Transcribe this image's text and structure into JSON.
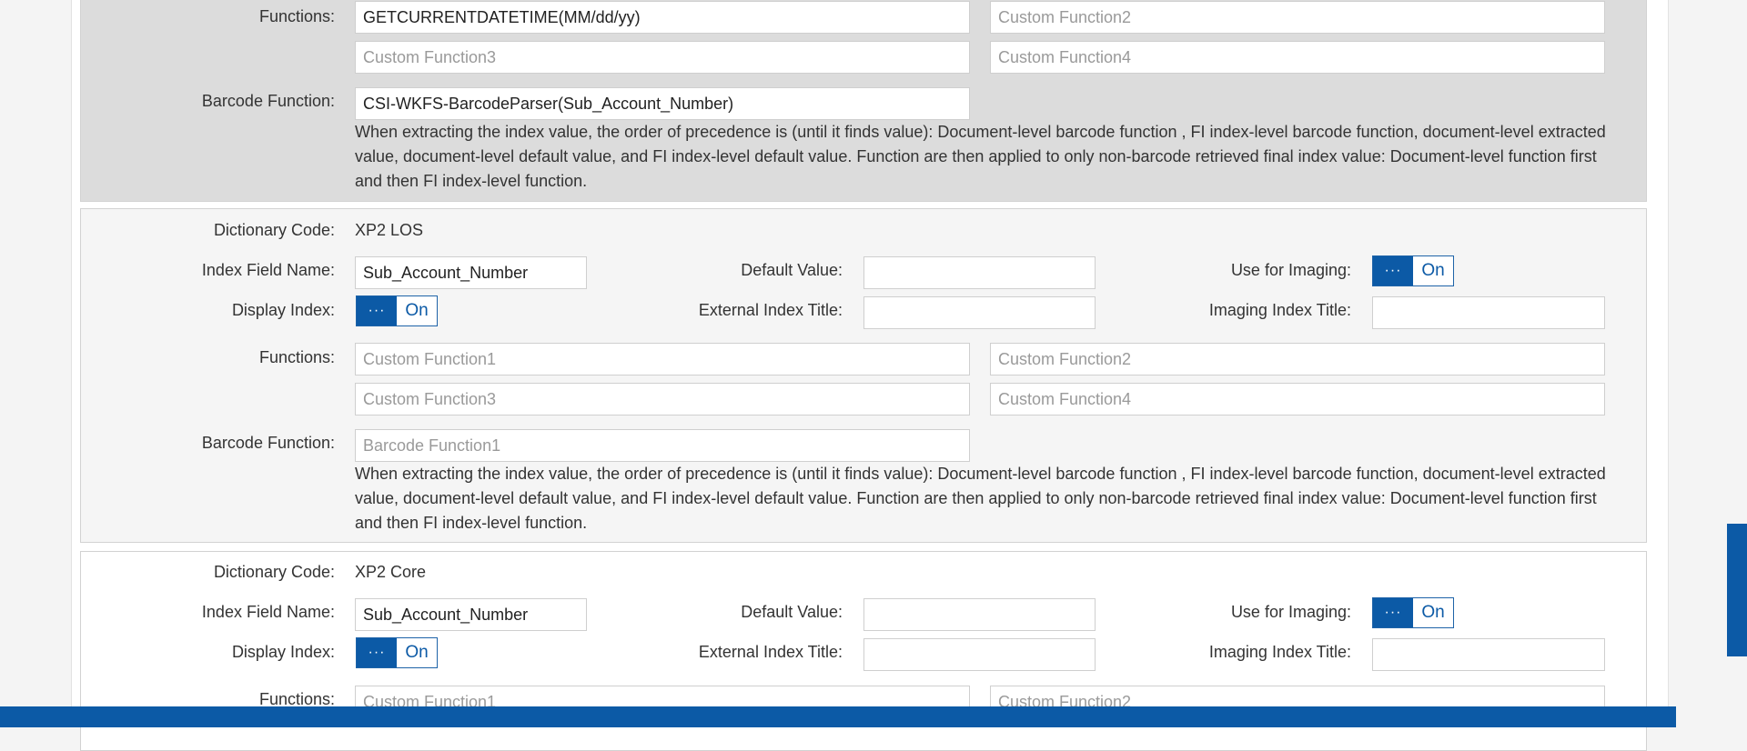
{
  "labels": {
    "functions": "Functions:",
    "barcode_function": "Barcode Function:",
    "dictionary_code": "Dictionary Code:",
    "index_field_name": "Index Field Name:",
    "default_value": "Default Value:",
    "use_for_imaging": "Use for Imaging:",
    "display_index": "Display Index:",
    "external_index_title": "External Index Title:",
    "imaging_index_title": "Imaging Index Title:"
  },
  "toggle": {
    "knob": "···",
    "on_label": "On"
  },
  "note": "When extracting the index value, the order of precedence is (until it finds value): Document-level barcode function , FI index-level barcode function, document-level extracted value, document-level default value, and FI index-level default value. Function are then applied to only non-barcode retrieved final index value: Document-level function first and then FI index-level function.",
  "placeholders": {
    "f1": "Custom Function1",
    "f2": "Custom Function2",
    "f3": "Custom Function3",
    "f4": "Custom Function4",
    "barcode": "Barcode Function1"
  },
  "sections": [
    {
      "function1_value": "GETCURRENTDATETIME(MM/dd/yy)",
      "barcode_value": "CSI-WKFS-BarcodeParser(Sub_Account_Number)"
    },
    {
      "dictionary_code": "XP2 LOS",
      "index_field_name": "Sub_Account_Number",
      "default_value": "",
      "external_index_title": "",
      "imaging_index_title": "",
      "use_for_imaging": "On",
      "display_index": "On"
    },
    {
      "dictionary_code": "XP2 Core",
      "index_field_name": "Sub_Account_Number",
      "default_value": "",
      "external_index_title": "",
      "imaging_index_title": "",
      "use_for_imaging": "On",
      "display_index": "On"
    }
  ],
  "colors": {
    "accent": "#0c5aa6",
    "panel_active": "#dcdcdc",
    "panel": "#f5f5f5"
  }
}
